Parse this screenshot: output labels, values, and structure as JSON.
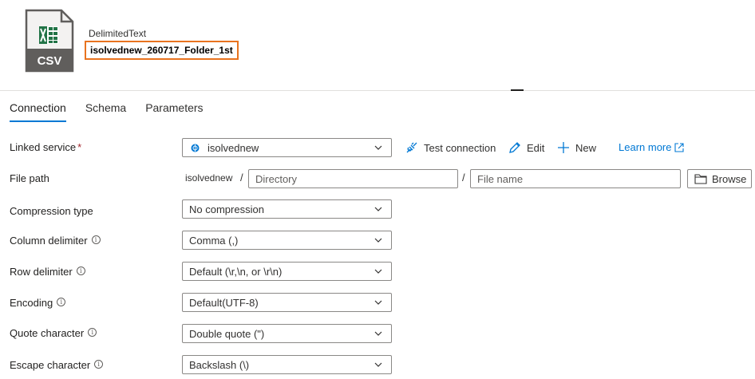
{
  "dataset": {
    "type": "DelimitedText",
    "name": "isolvednew_260717_Folder_1st",
    "icon": "csv-file-icon",
    "icon_text": "CSV"
  },
  "tabs": [
    {
      "label": "Connection",
      "active": true
    },
    {
      "label": "Schema",
      "active": false
    },
    {
      "label": "Parameters",
      "active": false
    }
  ],
  "linked_service": {
    "label": "Linked service",
    "required_mark": "*",
    "value": "isolvednew",
    "actions": {
      "test_connection": "Test connection",
      "edit": "Edit",
      "new": "New",
      "learn_more": "Learn more"
    }
  },
  "file_path": {
    "label": "File path",
    "prefix": "isolvednew",
    "separator": "/",
    "directory_placeholder": "Directory",
    "file_placeholder": "File name",
    "browse": "Browse"
  },
  "compression": {
    "label": "Compression type",
    "value": "No compression"
  },
  "column_delimiter": {
    "label": "Column delimiter",
    "value": "Comma (,)"
  },
  "row_delimiter": {
    "label": "Row delimiter",
    "value": "Default (\\r,\\n, or \\r\\n)"
  },
  "encoding": {
    "label": "Encoding",
    "value": "Default(UTF-8)"
  },
  "quote_character": {
    "label": "Quote character",
    "value": "Double quote (\")"
  },
  "escape_character": {
    "label": "Escape character",
    "value": "Backslash (\\)"
  },
  "info_glyph": "i",
  "colors": {
    "accent": "#0078d4",
    "highlight_border": "#e8731f",
    "excel_green": "#217346",
    "icon_gray": "#605e5c"
  }
}
